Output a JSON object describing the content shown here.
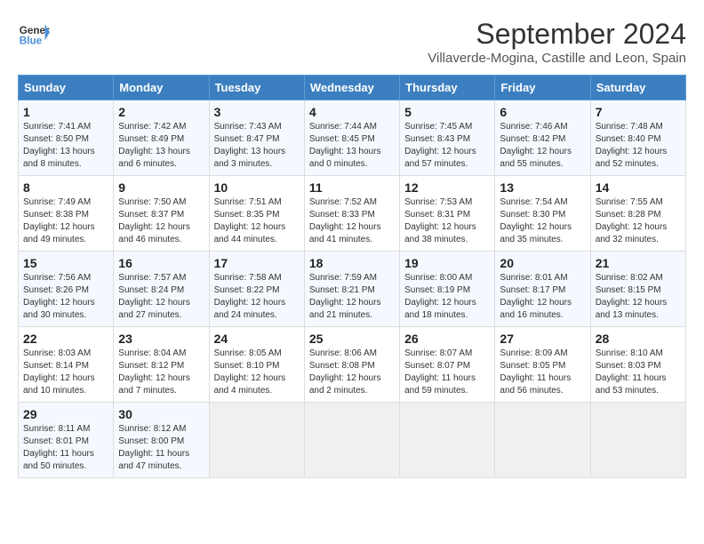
{
  "header": {
    "logo_line1": "General",
    "logo_line2": "Blue",
    "month": "September 2024",
    "location": "Villaverde-Mogina, Castille and Leon, Spain"
  },
  "weekdays": [
    "Sunday",
    "Monday",
    "Tuesday",
    "Wednesday",
    "Thursday",
    "Friday",
    "Saturday"
  ],
  "weeks": [
    [
      {
        "day": "1",
        "info": "Sunrise: 7:41 AM\nSunset: 8:50 PM\nDaylight: 13 hours and 8 minutes."
      },
      {
        "day": "2",
        "info": "Sunrise: 7:42 AM\nSunset: 8:49 PM\nDaylight: 13 hours and 6 minutes."
      },
      {
        "day": "3",
        "info": "Sunrise: 7:43 AM\nSunset: 8:47 PM\nDaylight: 13 hours and 3 minutes."
      },
      {
        "day": "4",
        "info": "Sunrise: 7:44 AM\nSunset: 8:45 PM\nDaylight: 13 hours and 0 minutes."
      },
      {
        "day": "5",
        "info": "Sunrise: 7:45 AM\nSunset: 8:43 PM\nDaylight: 12 hours and 57 minutes."
      },
      {
        "day": "6",
        "info": "Sunrise: 7:46 AM\nSunset: 8:42 PM\nDaylight: 12 hours and 55 minutes."
      },
      {
        "day": "7",
        "info": "Sunrise: 7:48 AM\nSunset: 8:40 PM\nDaylight: 12 hours and 52 minutes."
      }
    ],
    [
      {
        "day": "8",
        "info": "Sunrise: 7:49 AM\nSunset: 8:38 PM\nDaylight: 12 hours and 49 minutes."
      },
      {
        "day": "9",
        "info": "Sunrise: 7:50 AM\nSunset: 8:37 PM\nDaylight: 12 hours and 46 minutes."
      },
      {
        "day": "10",
        "info": "Sunrise: 7:51 AM\nSunset: 8:35 PM\nDaylight: 12 hours and 44 minutes."
      },
      {
        "day": "11",
        "info": "Sunrise: 7:52 AM\nSunset: 8:33 PM\nDaylight: 12 hours and 41 minutes."
      },
      {
        "day": "12",
        "info": "Sunrise: 7:53 AM\nSunset: 8:31 PM\nDaylight: 12 hours and 38 minutes."
      },
      {
        "day": "13",
        "info": "Sunrise: 7:54 AM\nSunset: 8:30 PM\nDaylight: 12 hours and 35 minutes."
      },
      {
        "day": "14",
        "info": "Sunrise: 7:55 AM\nSunset: 8:28 PM\nDaylight: 12 hours and 32 minutes."
      }
    ],
    [
      {
        "day": "15",
        "info": "Sunrise: 7:56 AM\nSunset: 8:26 PM\nDaylight: 12 hours and 30 minutes."
      },
      {
        "day": "16",
        "info": "Sunrise: 7:57 AM\nSunset: 8:24 PM\nDaylight: 12 hours and 27 minutes."
      },
      {
        "day": "17",
        "info": "Sunrise: 7:58 AM\nSunset: 8:22 PM\nDaylight: 12 hours and 24 minutes."
      },
      {
        "day": "18",
        "info": "Sunrise: 7:59 AM\nSunset: 8:21 PM\nDaylight: 12 hours and 21 minutes."
      },
      {
        "day": "19",
        "info": "Sunrise: 8:00 AM\nSunset: 8:19 PM\nDaylight: 12 hours and 18 minutes."
      },
      {
        "day": "20",
        "info": "Sunrise: 8:01 AM\nSunset: 8:17 PM\nDaylight: 12 hours and 16 minutes."
      },
      {
        "day": "21",
        "info": "Sunrise: 8:02 AM\nSunset: 8:15 PM\nDaylight: 12 hours and 13 minutes."
      }
    ],
    [
      {
        "day": "22",
        "info": "Sunrise: 8:03 AM\nSunset: 8:14 PM\nDaylight: 12 hours and 10 minutes."
      },
      {
        "day": "23",
        "info": "Sunrise: 8:04 AM\nSunset: 8:12 PM\nDaylight: 12 hours and 7 minutes."
      },
      {
        "day": "24",
        "info": "Sunrise: 8:05 AM\nSunset: 8:10 PM\nDaylight: 12 hours and 4 minutes."
      },
      {
        "day": "25",
        "info": "Sunrise: 8:06 AM\nSunset: 8:08 PM\nDaylight: 12 hours and 2 minutes."
      },
      {
        "day": "26",
        "info": "Sunrise: 8:07 AM\nSunset: 8:07 PM\nDaylight: 11 hours and 59 minutes."
      },
      {
        "day": "27",
        "info": "Sunrise: 8:09 AM\nSunset: 8:05 PM\nDaylight: 11 hours and 56 minutes."
      },
      {
        "day": "28",
        "info": "Sunrise: 8:10 AM\nSunset: 8:03 PM\nDaylight: 11 hours and 53 minutes."
      }
    ],
    [
      {
        "day": "29",
        "info": "Sunrise: 8:11 AM\nSunset: 8:01 PM\nDaylight: 11 hours and 50 minutes."
      },
      {
        "day": "30",
        "info": "Sunrise: 8:12 AM\nSunset: 8:00 PM\nDaylight: 11 hours and 47 minutes."
      },
      {
        "day": "",
        "info": ""
      },
      {
        "day": "",
        "info": ""
      },
      {
        "day": "",
        "info": ""
      },
      {
        "day": "",
        "info": ""
      },
      {
        "day": "",
        "info": ""
      }
    ]
  ]
}
